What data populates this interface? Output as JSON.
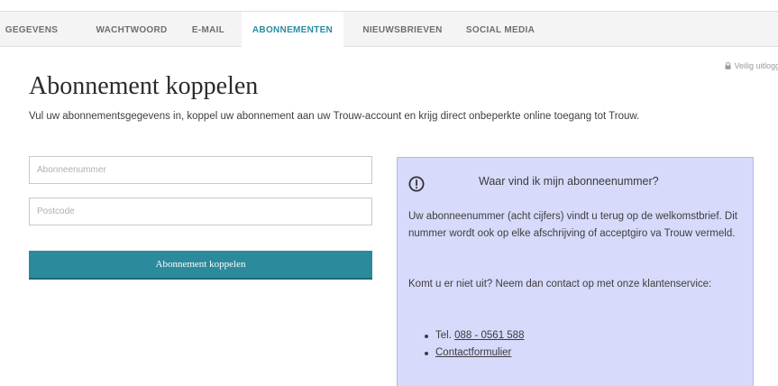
{
  "tabs": [
    {
      "label": "GEGEVENS",
      "active": false
    },
    {
      "label": "WACHTWOORD",
      "active": false
    },
    {
      "label": "E-MAIL",
      "active": false
    },
    {
      "label": "ABONNEMENTEN",
      "active": true
    },
    {
      "label": "NIEUWSBRIEVEN",
      "active": false
    },
    {
      "label": "SOCIAL MEDIA",
      "active": false
    }
  ],
  "logout": {
    "label": "Veilig uitloggen",
    "icon": "lock-icon"
  },
  "page": {
    "title": "Abonnement koppelen",
    "intro": "Vul uw abonnementsgegevens in, koppel uw abonnement aan uw Trouw-account en krijg direct onbeperkte online toegang tot Trouw."
  },
  "form": {
    "subscriber_number": {
      "placeholder": "Abonneenummer",
      "value": ""
    },
    "postcode": {
      "placeholder": "Postcode",
      "value": ""
    },
    "submit_label": "Abonnement koppelen"
  },
  "info": {
    "icon": "info-circle-icon",
    "title": "Waar vind ik mijn abonneenummer?",
    "text": "Uw abonneenummer (acht cijfers) vindt u terug op de welkomstbrief. Dit nummer wordt ook op elke afschrijving of acceptgiro va Trouw vermeld.",
    "text2": "Komt u er niet uit? Neem dan contact op met onze klantenservice:",
    "contact": {
      "phone_prefix": "Tel. ",
      "phone": "088 - 0561 588",
      "form_link": "Contactformulier"
    }
  },
  "colors": {
    "accent": "#2b8a9c",
    "active_tab": "#2b8ca0",
    "info_bg": "#d7dafa"
  }
}
